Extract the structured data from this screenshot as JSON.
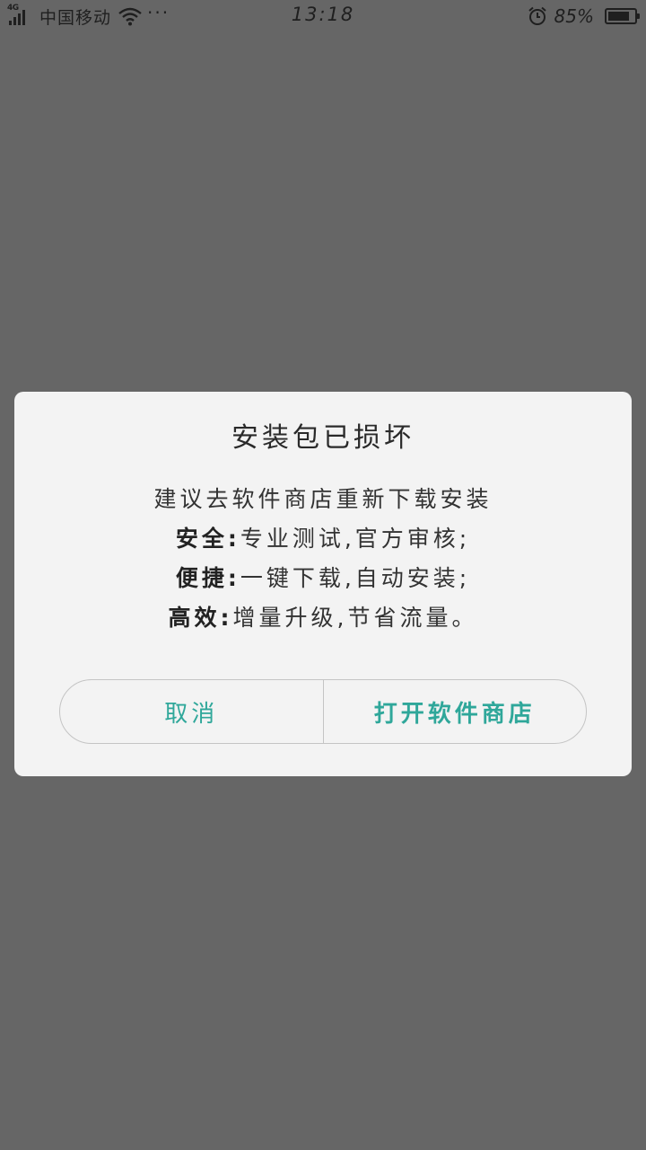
{
  "status_bar": {
    "network_type": "4G",
    "carrier": "中国移动",
    "more": "···",
    "time": "13:18",
    "battery_percent": "85%",
    "battery_level": 0.85,
    "icons": [
      "signal-icon",
      "wifi-icon",
      "alarm-icon",
      "battery-icon"
    ]
  },
  "dialog": {
    "title": "安装包已损坏",
    "message": "建议去软件商店重新下载安装",
    "features": [
      {
        "label": "安全:",
        "text": "专业测试,官方审核;"
      },
      {
        "label": "便捷:",
        "text": "一键下载,自动安装;"
      },
      {
        "label": "高效:",
        "text": "增量升级,节省流量。"
      }
    ],
    "cancel_label": "取消",
    "confirm_label": "打开软件商店"
  },
  "colors": {
    "backdrop": "#666666",
    "dialog_bg": "#f3f3f3",
    "accent": "#2fa79a",
    "text": "#333333"
  }
}
